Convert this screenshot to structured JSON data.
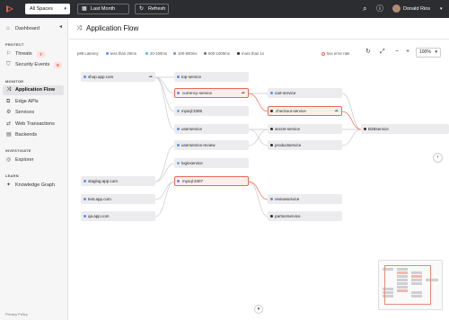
{
  "topbar": {
    "space_select": "All Spaces",
    "date_button": "Last Month",
    "refresh_button": "Refresh",
    "user_name": "Donald Rios"
  },
  "sidebar": {
    "dashboard": "Dashboard",
    "section_protect": "PROTECT",
    "threats": "Threats",
    "threats_count": "7",
    "security_events": "Security Events",
    "security_events_count": "6",
    "section_monitor": "MONITOR",
    "application_flow": "Application Flow",
    "edge_apis": "Edge APIs",
    "services": "Services",
    "web_transactions": "Web Transactions",
    "backends": "Backends",
    "section_investigate": "INVESTIGATE",
    "explorer": "Explorer",
    "section_learn": "LEARN",
    "knowledge_graph": "Knowledge Graph",
    "privacy": "Privacy Policy"
  },
  "main": {
    "title": "Application Flow",
    "legend": {
      "label": "p99 Latency:",
      "items": [
        {
          "text": "less than 20ms",
          "color": "#5b8ff0"
        },
        {
          "text": "20-100ms",
          "color": "#5bb6e0"
        },
        {
          "text": "100-500ms",
          "color": "#7b8cc4"
        },
        {
          "text": "500-1000ms",
          "color": "#6b6f78"
        },
        {
          "text": "more than 1s",
          "color": "#2a2b2f"
        }
      ],
      "error": {
        "text": "5xx error rate",
        "color": "#e86a55"
      }
    },
    "zoom": "100%"
  },
  "nodes": {
    "shop": "shop.app.com",
    "staging": "staging.app.com",
    "test": "test.app.com",
    "qa": "qa.app.com",
    "top": "top-service",
    "currency": "currency-service",
    "mysql3306": "mysql:3306",
    "user": "userservice",
    "userreview": "userservice-review",
    "login": "loginservice",
    "mysql3307": "mysql:3307",
    "cart": "cart-service",
    "checkout": "checkout-service",
    "secret": "secret-service",
    "product": "productservice",
    "review": "reviewservice",
    "partner": "partnerservice",
    "b2b": "B2Bservice"
  },
  "colors": {
    "error_border": "#e86a55",
    "edge_normal": "#c9c9cd",
    "edge_error": "#e86a55",
    "fast": "#5b8ff0",
    "slow": "#2a2b2f"
  }
}
